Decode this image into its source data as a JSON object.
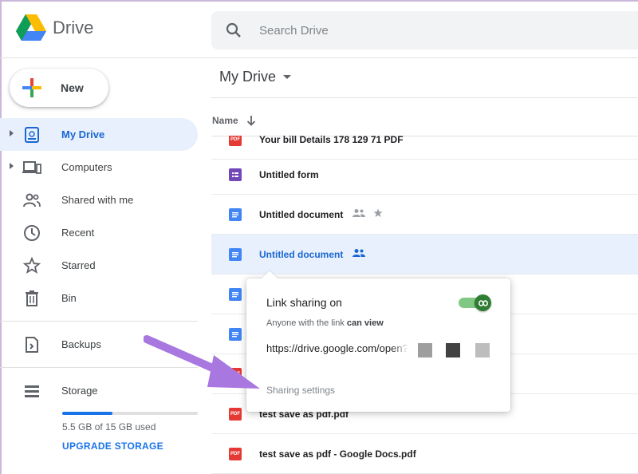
{
  "app": {
    "title": "Drive"
  },
  "search": {
    "placeholder": "Search Drive"
  },
  "new_button": {
    "label": "New"
  },
  "sidebar": {
    "items": [
      {
        "label": "My Drive",
        "icon": "my-drive-icon",
        "active": true,
        "expandable": true
      },
      {
        "label": "Computers",
        "icon": "computers-icon",
        "active": false,
        "expandable": true
      },
      {
        "label": "Shared with me",
        "icon": "shared-with-me-icon",
        "active": false
      },
      {
        "label": "Recent",
        "icon": "clock-icon",
        "active": false
      },
      {
        "label": "Starred",
        "icon": "star-icon",
        "active": false
      },
      {
        "label": "Bin",
        "icon": "trash-icon",
        "active": false
      }
    ],
    "backups": {
      "label": "Backups",
      "icon": "backups-icon"
    },
    "storage": {
      "label": "Storage",
      "icon": "storage-icon",
      "used_text": "5.5 GB of 15 GB used",
      "used_fraction": 0.37,
      "upgrade_label": "UPGRADE STORAGE"
    }
  },
  "main": {
    "title": "My Drive",
    "column_header": "Name",
    "files": [
      {
        "name": "Your bill Details 178 129 71 PDF",
        "type": "pdf"
      },
      {
        "name": "Untitled form",
        "type": "form"
      },
      {
        "name": "Untitled document",
        "type": "doc",
        "shared": true,
        "starred": true
      },
      {
        "name": "Untitled document",
        "type": "doc",
        "shared": true,
        "selected": true
      },
      {
        "name": "",
        "type": "doc"
      },
      {
        "name": "",
        "type": "doc"
      },
      {
        "name": "",
        "type": "pdf"
      },
      {
        "name": "test save as pdf.pdf",
        "type": "pdf"
      },
      {
        "name": "test save as pdf - Google Docs.pdf",
        "type": "pdf"
      }
    ]
  },
  "popup": {
    "title": "Link sharing on",
    "subtitle_prefix": "Anyone with the link",
    "subtitle_bold": "can view",
    "link": "https://drive.google.com/open?id=",
    "sharing_settings": "Sharing settings",
    "toggle_on": true
  },
  "colors": {
    "accent": "#1a73e8",
    "selected_bg": "#e8f0fe",
    "doc": "#4285f4",
    "form": "#7248b9",
    "pdf": "#e53935",
    "toggle": "#2e7d32",
    "arrow": "#a877e0"
  }
}
